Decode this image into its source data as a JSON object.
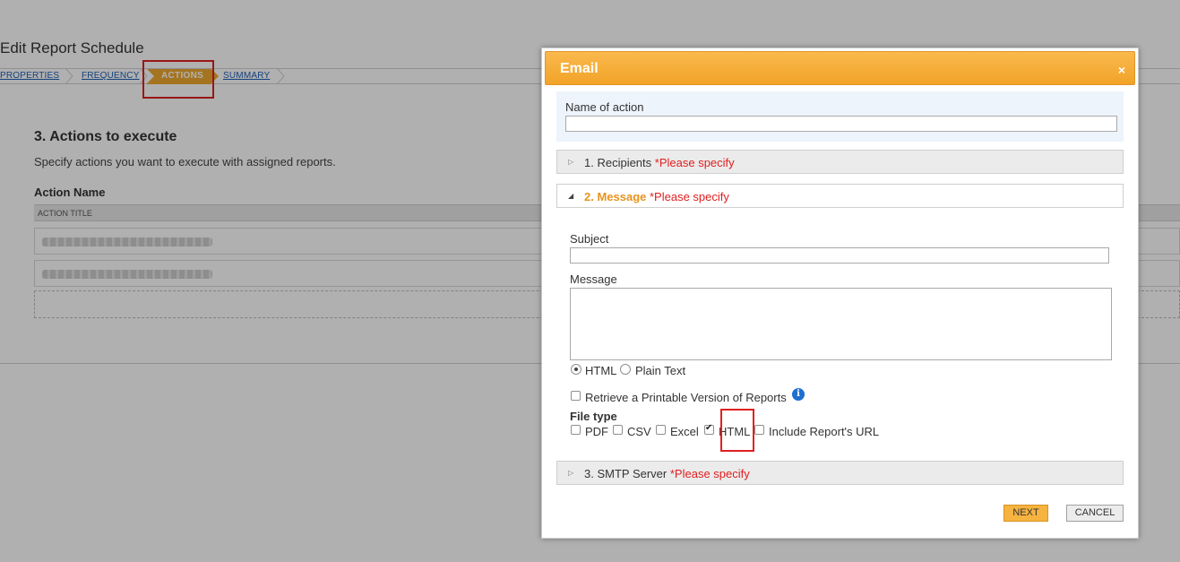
{
  "page": {
    "title": "Edit Report Schedule",
    "wizard_steps": [
      "PROPERTIES",
      "FREQUENCY",
      "ACTIONS",
      "SUMMARY"
    ],
    "active_step": "ACTIONS",
    "section_heading": "3. Actions to execute",
    "section_description": "Specify actions you want to execute with assigned reports.",
    "action_name_label": "Action Name",
    "table_header": "ACTION TITLE"
  },
  "modal": {
    "title": "Email",
    "close_icon": "×",
    "name_label": "Name of action",
    "name_value": "",
    "sections": [
      {
        "label": "1. Recipients",
        "warning": "*Please specify",
        "expanded": false
      },
      {
        "label": "2. Message",
        "warning": "*Please specify",
        "expanded": true
      },
      {
        "label": "3. SMTP Server",
        "warning": "*Please specify",
        "expanded": false
      }
    ],
    "subject_label": "Subject",
    "subject_value": "",
    "message_label": "Message",
    "message_value": "",
    "format_options": [
      {
        "label": "HTML",
        "selected": true
      },
      {
        "label": "Plain Text",
        "selected": false
      }
    ],
    "printable_label": "Retrieve a Printable Version of Reports",
    "file_type_label": "File type",
    "file_types": [
      {
        "label": "PDF",
        "checked": false
      },
      {
        "label": "CSV",
        "checked": false
      },
      {
        "label": "Excel",
        "checked": false
      },
      {
        "label": "HTML",
        "checked": true
      },
      {
        "label": "Include Report's URL",
        "checked": false
      }
    ],
    "next_label": "NEXT",
    "cancel_label": "CANCEL"
  },
  "colors": {
    "accent": "#f2a328",
    "warning": "#e02020",
    "highlight_box": "#e02020",
    "info": "#1d6fd0"
  }
}
